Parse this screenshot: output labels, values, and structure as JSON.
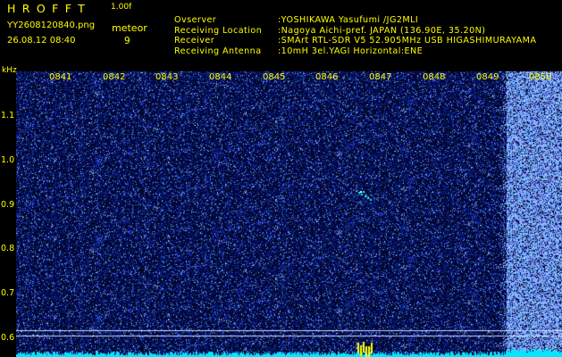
{
  "app": {
    "title": "HROFFT",
    "version": "1.00f",
    "filename": "YY2608120840.png",
    "timestamp": "26.08.12 08:40",
    "meteor_label": "meteor",
    "meteor_count": "9"
  },
  "info": [
    {
      "label": "Ovserver",
      "value": ":YOSHIKAWA Yasufumi /JG2MLI"
    },
    {
      "label": "Receiving Location",
      "value": ":Nagoya Aichi-pref. JAPAN (136.90E, 35.20N)"
    },
    {
      "label": "Receiver",
      "value": ":SMArt RTL-SDR V5 52.905MHz USB HIGASHIMURAYAMA"
    },
    {
      "label": "Receiving Antenna",
      "value": ":10mH 3el.YAGI Horizontal:ENE"
    }
  ],
  "axis": {
    "y_unit": "kHz",
    "y_ticks": [
      "1.1",
      "1.0",
      "0.9",
      "0.8",
      "0.7",
      "0.6"
    ],
    "x_ticks": [
      "0841",
      "0842",
      "0843",
      "0844",
      "0845",
      "0846",
      "0847",
      "0848",
      "0849",
      "0850"
    ]
  },
  "colors": {
    "label": "#ffff00",
    "background": "#000000",
    "noise_dark": "#040e38",
    "noise_mid": "#1c2cc0",
    "noise_bright": "#6090ff",
    "cyan": "#00ffff"
  }
}
